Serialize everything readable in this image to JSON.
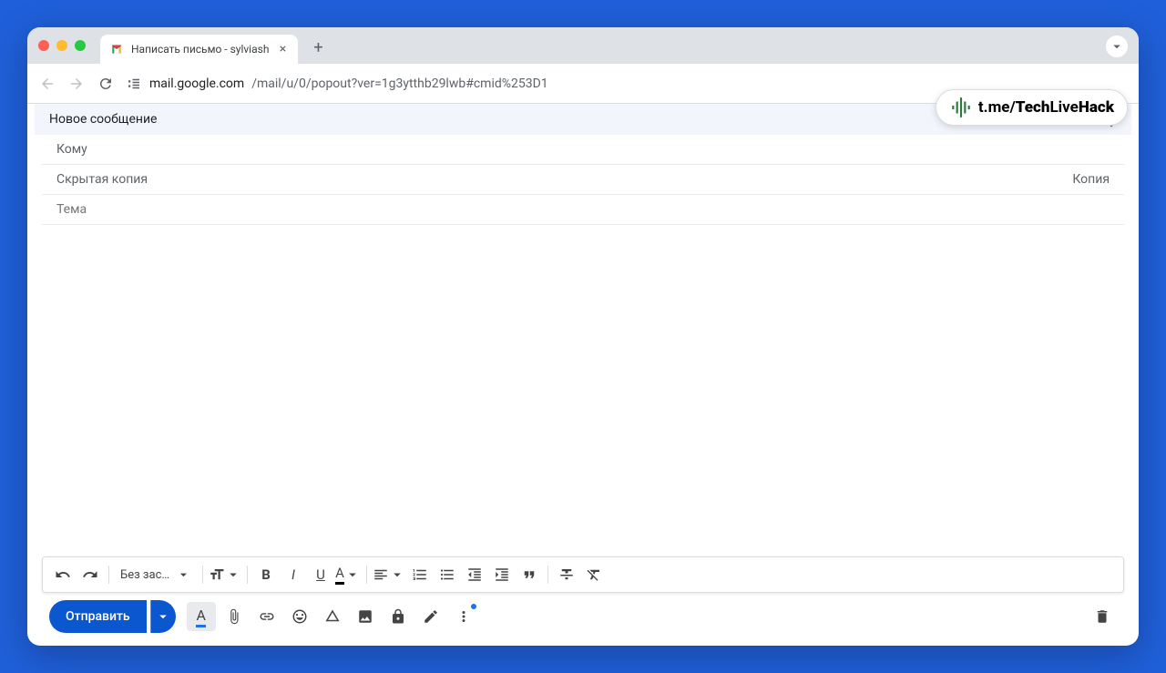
{
  "tab": {
    "title": "Написать письмо - sylviash"
  },
  "url": {
    "domain": "mail.google.com",
    "path": "/mail/u/0/popout?ver=1g3ytthb29lwb#cmid%253D1"
  },
  "watermark": {
    "prefix": "t.me/",
    "bold1": "Tech",
    "rest": "Live",
    "bold2": "Hack"
  },
  "compose": {
    "title": "Новое сообщение",
    "to_label": "Кому",
    "bcc_label": "Скрытая копия",
    "cc_label": "Копия",
    "subject_placeholder": "Тема"
  },
  "format": {
    "font": "Без засе…"
  },
  "send": {
    "label": "Отправить"
  }
}
